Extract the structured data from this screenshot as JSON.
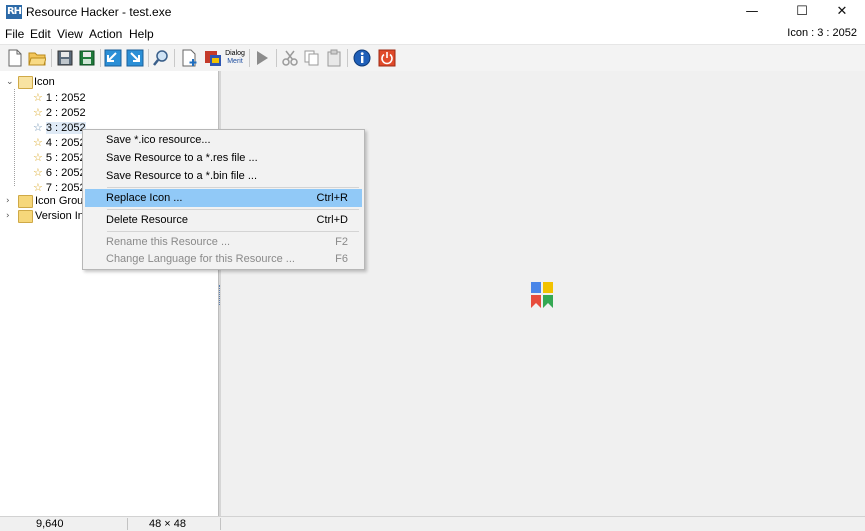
{
  "window": {
    "title": "Resource Hacker - test.exe",
    "logo_text": "RH",
    "minimize_glyph": "—",
    "maximize_glyph": "☐",
    "close_glyph": "✕"
  },
  "menubar": {
    "items": [
      "File",
      "Edit",
      "View",
      "Action",
      "Help"
    ],
    "status_info": "Icon : 3 : 2052"
  },
  "toolbar": {
    "buttons": [
      "new-file-icon",
      "open-folder-icon",
      "save-icon",
      "save-as-icon",
      "back-icon",
      "forward-icon",
      "find-icon",
      "add-resource-icon",
      "dialog-icon",
      "dialog-menu-icon",
      "run-script-icon",
      "cut-icon",
      "copy-icon",
      "paste-icon",
      "info-icon",
      "exit-icon"
    ],
    "dialog_label_line1": "Dialog",
    "dialog_label_line2": "Merit"
  },
  "tree": {
    "root": {
      "label": "Icon",
      "expanded": true
    },
    "children": [
      {
        "label": "1 : 2052"
      },
      {
        "label": "2 : 2052"
      },
      {
        "label": "3 : 2052",
        "selected": true
      },
      {
        "label": "4 : 2052"
      },
      {
        "label": "5 : 2052"
      },
      {
        "label": "6 : 2052"
      },
      {
        "label": "7 : 2052"
      }
    ],
    "siblings": [
      {
        "label": "Icon Group"
      },
      {
        "label": "Version Info"
      }
    ]
  },
  "context_menu": {
    "items": [
      {
        "label": "Save *.ico resource...",
        "shortcut": ""
      },
      {
        "label": "Save Resource to a *.res file ...",
        "shortcut": ""
      },
      {
        "label": "Save Resource to a *.bin file ...",
        "shortcut": ""
      },
      {
        "label": "Replace Icon ...",
        "shortcut": "Ctrl+R",
        "highlighted": true
      },
      {
        "label": "Delete Resource",
        "shortcut": "Ctrl+D"
      },
      {
        "label": "Rename this Resource ...",
        "shortcut": "F2",
        "disabled": true
      },
      {
        "label": "Change Language for this Resource ...",
        "shortcut": "F6",
        "disabled": true
      }
    ]
  },
  "statusbar": {
    "size": "9,640",
    "dimensions": "48 × 48"
  },
  "colors": {
    "highlight": "#91c9f7",
    "preview_blue": "#4a86e8",
    "preview_yellow": "#f2c200",
    "preview_red": "#e74c3c",
    "preview_green": "#34a853"
  }
}
